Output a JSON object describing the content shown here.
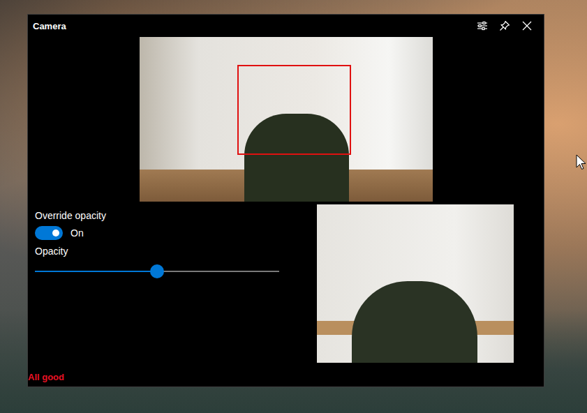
{
  "window": {
    "title": "Camera"
  },
  "main_feed": {
    "face_box": true
  },
  "override_opacity": {
    "label": "Override opacity",
    "on": true,
    "state_text": "On"
  },
  "opacity": {
    "label": "Opacity",
    "level": 0.5
  },
  "status": {
    "text": "All good"
  }
}
